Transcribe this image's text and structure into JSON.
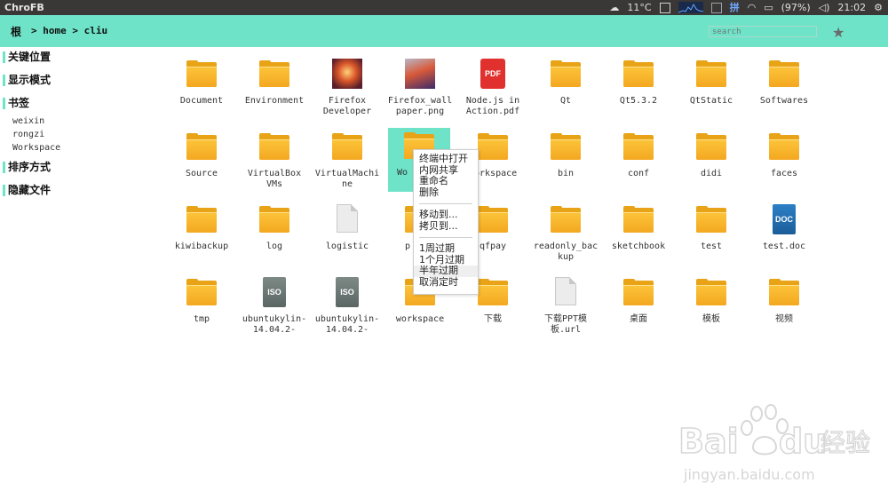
{
  "window": {
    "app_title": "ChroFB"
  },
  "tray": {
    "weather": "11°C",
    "battery": "(97%)",
    "time": "21:02",
    "input_method": "拼"
  },
  "pathbar": {
    "root_label": "根",
    "path": "> home > cliu",
    "search_placeholder": "search"
  },
  "sidebar": {
    "key_locations": "关键位置",
    "display_mode": "显示模式",
    "bookmarks_title": "书签",
    "bookmarks": [
      "weixin",
      "rongzi",
      "Workspace"
    ],
    "sort_mode": "排序方式",
    "hidden_files": "隐藏文件"
  },
  "files": [
    {
      "name": "Document",
      "type": "folder"
    },
    {
      "name": "Environment",
      "type": "folder"
    },
    {
      "name": "Firefox Developer",
      "type": "image"
    },
    {
      "name": "Firefox_wallpaper.png",
      "type": "image"
    },
    {
      "name": "Node.js in Action.pdf",
      "type": "pdf"
    },
    {
      "name": "Qt",
      "type": "folder"
    },
    {
      "name": "Qt5.3.2",
      "type": "folder"
    },
    {
      "name": "QtStatic",
      "type": "folder"
    },
    {
      "name": "Softwares",
      "type": "folder"
    },
    {
      "name": "Source",
      "type": "folder"
    },
    {
      "name": "VirtualBox VMs",
      "type": "folder"
    },
    {
      "name": "VirtualMachine",
      "type": "folder"
    },
    {
      "name": "Wo",
      "type": "folder"
    },
    {
      "name": "orkspace",
      "type": "folder"
    },
    {
      "name": "bin",
      "type": "folder"
    },
    {
      "name": "conf",
      "type": "folder"
    },
    {
      "name": "didi",
      "type": "folder"
    },
    {
      "name": "faces",
      "type": "folder"
    },
    {
      "name": "kiwibackup",
      "type": "folder"
    },
    {
      "name": "log",
      "type": "folder"
    },
    {
      "name": "logistic",
      "type": "file"
    },
    {
      "name": "p",
      "type": "folder"
    },
    {
      "name": "qfpay",
      "type": "folder"
    },
    {
      "name": "readonly_backup",
      "type": "folder"
    },
    {
      "name": "sketchbook",
      "type": "folder"
    },
    {
      "name": "test",
      "type": "folder"
    },
    {
      "name": "test.doc",
      "type": "doc"
    },
    {
      "name": "tmp",
      "type": "folder"
    },
    {
      "name": "ubuntukylin-14.04.2-",
      "type": "iso"
    },
    {
      "name": "ubuntukylin-14.04.2-",
      "type": "iso"
    },
    {
      "name": "workspace",
      "type": "folder"
    },
    {
      "name": "下载",
      "type": "folder"
    },
    {
      "name": "下载PPT模板.url",
      "type": "file"
    },
    {
      "name": "桌面",
      "type": "folder"
    },
    {
      "name": "模板",
      "type": "folder"
    },
    {
      "name": "视频",
      "type": "folder"
    }
  ],
  "context_menu": {
    "group1": [
      "终端中打开",
      "内网共享",
      "重命名",
      "删除"
    ],
    "group2": [
      "移动到...",
      "拷贝到..."
    ],
    "group3": [
      "1周过期",
      "1个月过期",
      "半年过期",
      "取消定时"
    ]
  },
  "watermark": {
    "brand": "Bai",
    "brand2": "du",
    "cn": "经验",
    "url": "jingyan.baidu.com"
  },
  "colors": {
    "accent": "#6ee3c8",
    "folder": "#f6b428",
    "topbar": "#3a3836"
  }
}
